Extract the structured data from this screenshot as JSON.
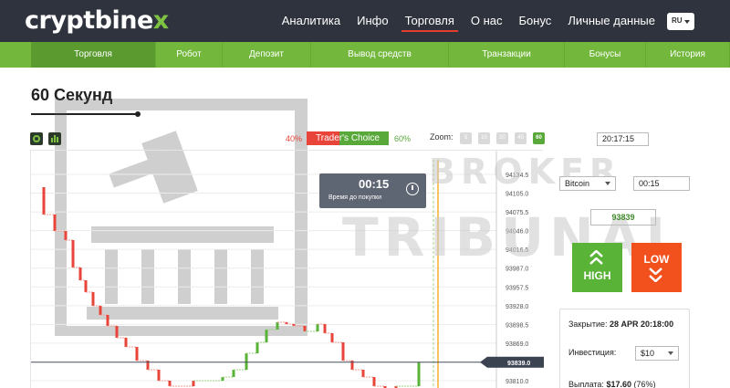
{
  "header": {
    "logo_main": "cryptbine",
    "logo_x": "x",
    "nav": [
      {
        "label": "Аналитика",
        "active": false
      },
      {
        "label": "Инфо",
        "active": false
      },
      {
        "label": "Торговля",
        "active": true
      },
      {
        "label": "О нас",
        "active": false
      },
      {
        "label": "Бонус",
        "active": false
      },
      {
        "label": "Личные данные",
        "active": false
      }
    ],
    "lang": "RU"
  },
  "subnav": [
    {
      "label": "Торговля",
      "active": true
    },
    {
      "label": "Робот",
      "active": false
    },
    {
      "label": "Депозит",
      "active": false
    },
    {
      "label": "Вывод средств",
      "active": false
    },
    {
      "label": "Транзакции",
      "active": false
    },
    {
      "label": "Бонусы",
      "active": false
    },
    {
      "label": "История",
      "active": false
    }
  ],
  "page": {
    "title": "60 Секунд"
  },
  "toolbar": {
    "sentiment_left": "40%",
    "sentiment_label": "Trader's Choice",
    "sentiment_right": "60%",
    "sentiment_fraction_low": 0.4,
    "zoom_label": "Zoom:",
    "zoom_options": [
      "5",
      "10",
      "20",
      "40",
      "60"
    ],
    "zoom_active": "60",
    "time": "20:17:15"
  },
  "timer": {
    "value": "00:15",
    "label": "Время до покупки"
  },
  "watermark": {
    "line1": "BROKER",
    "line2": "TRIBUNAL"
  },
  "chart": {
    "price_ticks": [
      "94134.5",
      "94105.0",
      "94075.5",
      "94046.0",
      "94016.5",
      "93987.0",
      "93957.5",
      "93928.0",
      "93898.5",
      "93869.0",
      "93839.5",
      "93810.0"
    ],
    "current_price": "93839.0",
    "current_price_value": 93839.0
  },
  "panel": {
    "asset": "Bitcoin",
    "expiry": "00:15",
    "price": "93839",
    "high_label": "HIGH",
    "low_label": "LOW",
    "closing_label": "Закрытие:",
    "closing_value": "28 APR 20:18:00",
    "investment_label": "Инвестиция:",
    "investment_value": "$10",
    "payout_label": "Выплата:",
    "payout_value": "$17.60",
    "payout_pct": "(76%)"
  },
  "colors": {
    "header_bg": "#2f333e",
    "green": "#73b83c",
    "up": "#59b337",
    "down": "#f2511e"
  }
}
